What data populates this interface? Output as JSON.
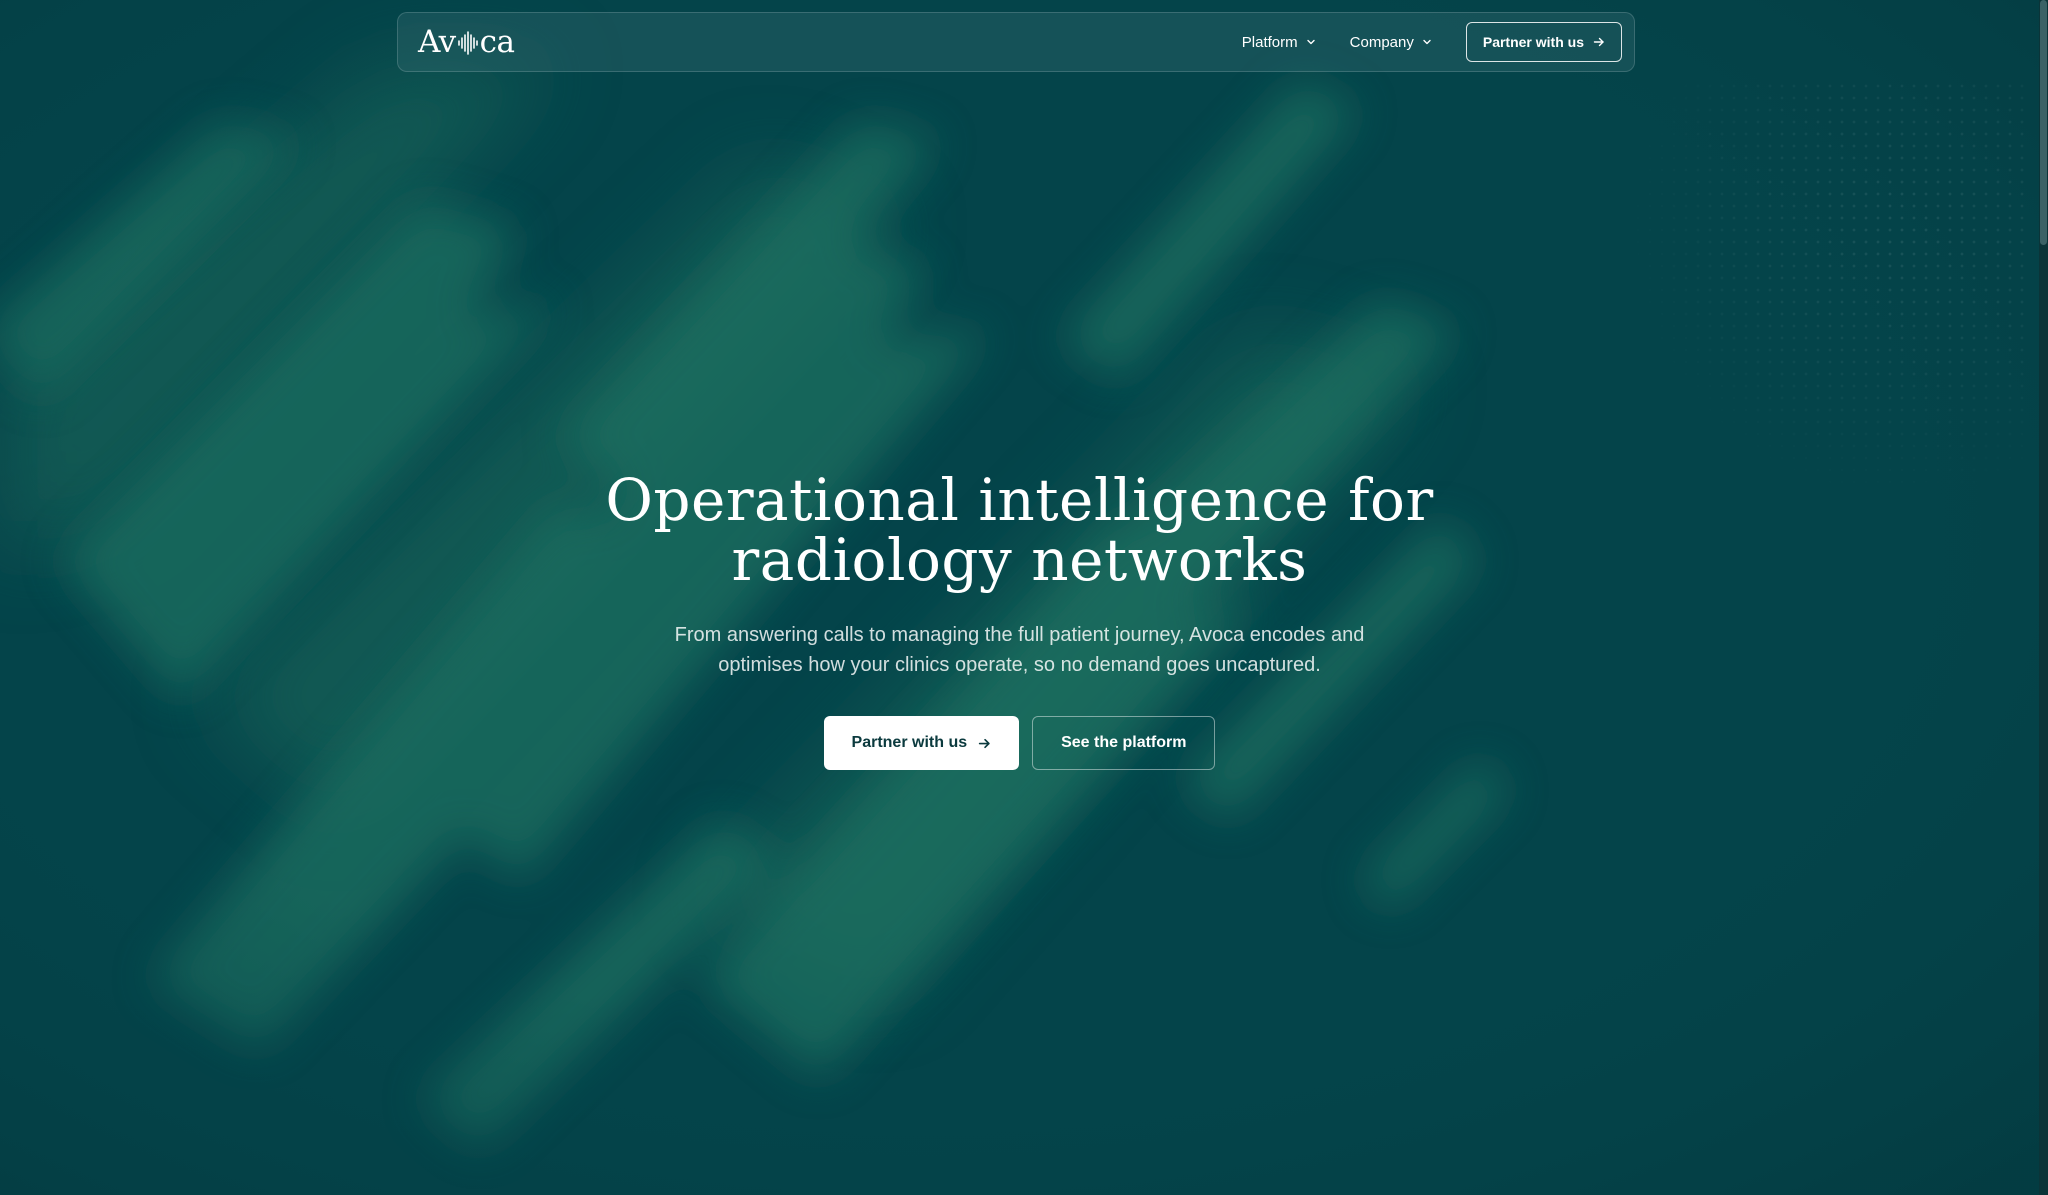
{
  "colors": {
    "background": "#04444a",
    "streak": "#1b6a5d",
    "primary_button_bg": "#ffffff",
    "primary_button_text": "#0b3a3e",
    "text": "#ffffff"
  },
  "nav": {
    "logo_text_left": "Av",
    "logo_mark_icon": "waveform-icon",
    "logo_text_right": "ca",
    "items": [
      {
        "label": "Platform",
        "icon": "chevron-down-icon"
      },
      {
        "label": "Company",
        "icon": "chevron-down-icon"
      }
    ],
    "cta_label": "Partner with us",
    "cta_icon": "arrow-right-icon"
  },
  "hero": {
    "title_line1": "Operational intelligence for",
    "title_line2": "radiology networks",
    "subtitle": "From answering calls to managing the full patient journey, Avoca encodes and optimises how your clinics operate, so no demand goes uncaptured.",
    "primary_button": "Partner with us",
    "primary_button_icon": "arrow-right-icon",
    "secondary_button": "See the platform"
  }
}
